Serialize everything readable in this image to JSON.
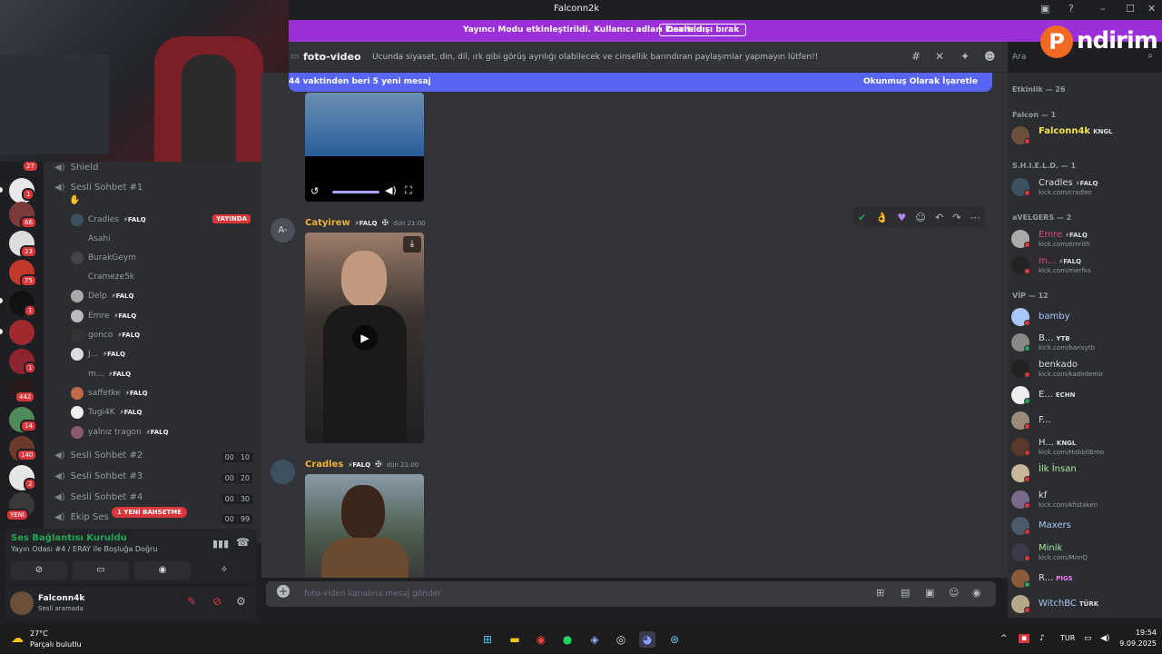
{
  "window": {
    "title": "Falconn2k",
    "minimize": "–",
    "maximize": "☐",
    "close": "✕"
  },
  "banner": {
    "message": "Yayıncı Modu etkinleştirildi. Kullanıcı adları kısaltıldı.",
    "button": "Devre dışı bırak"
  },
  "promo": {
    "logo_letter": "P",
    "text": "ndirim"
  },
  "channel": {
    "name": "foto-video",
    "topic": "Ucunda siyaset, din, dil, ırk gibi görüş ayrılığı olabilecek ve cinsellik barındıran paylaşımlar yapmayın lütfen!!",
    "search_placeholder": "Ara"
  },
  "new_messages": {
    "text": "44 vaktinden beri 5 yeni mesaj",
    "mark_read": "Okunmuş Olarak İşaretle"
  },
  "messages": [
    {
      "author": "Catyirew",
      "tag": "⚡FALQ",
      "time": "dün 21:00",
      "avatar_text": "A-"
    },
    {
      "author": "Cradles",
      "tag": "⚡FALQ",
      "time": "dün 21:00"
    }
  ],
  "composer": {
    "placeholder": "foto-video kanalına mesaj gönder"
  },
  "sidebar": {
    "top_channel": "Shield",
    "voice_channels": [
      {
        "name": "Sesli Sohbet #1",
        "emoji": "✋"
      },
      {
        "name": "Sesli Sohbet #2",
        "count_a": "00",
        "count_b": "10"
      },
      {
        "name": "Sesli Sohbet #3",
        "count_a": "00",
        "count_b": "20"
      },
      {
        "name": "Sesli Sohbet #4",
        "count_a": "00",
        "count_b": "30"
      },
      {
        "name": "Ekip Ses",
        "count_a": "00",
        "count_b": "99"
      }
    ],
    "live_badge": "YAYINDA",
    "new_mention": "1 YENİ BAHSETME",
    "new_label": "YENİ",
    "voice_users": [
      {
        "name": "Cradles",
        "tag": "⚡FALQ"
      },
      {
        "name": "Asahi",
        "tag": ""
      },
      {
        "name": "BurakGeym",
        "tag": ""
      },
      {
        "name": "Crameze5k",
        "tag": ""
      },
      {
        "name": "Delp",
        "tag": "⚡FALQ"
      },
      {
        "name": "Emre",
        "tag": "⚡FALQ"
      },
      {
        "name": "gonco",
        "tag": "⚡FALQ"
      },
      {
        "name": "J...",
        "tag": "⚡FALQ"
      },
      {
        "name": "m...",
        "tag": "⚡FALQ"
      },
      {
        "name": "saffetke",
        "tag": "⚡FALQ"
      },
      {
        "name": "Tugi4K",
        "tag": "⚡FALQ"
      },
      {
        "name": "yalnız tragon",
        "tag": "⚡FALQ"
      }
    ]
  },
  "rail_badges": [
    "27",
    "1",
    "66",
    "23",
    "75",
    "1",
    "1",
    "442",
    "14",
    "140",
    "2"
  ],
  "voice_panel": {
    "status": "Ses Bağlantısı Kuruldu",
    "room": "Yayın Odası #4 / ERAY ile Boşluğa Doğru"
  },
  "user_panel": {
    "name": "Falconn4k",
    "status": "Sesli aramada"
  },
  "members": {
    "activity": "Etkinlik — 26",
    "groups": [
      {
        "title": "Falcon — 1"
      },
      {
        "title": "S.H.I.E.L.D. — 1"
      },
      {
        "title": "aVELGERS — 2"
      },
      {
        "title": "VİP — 12"
      }
    ],
    "list": [
      {
        "name": "Falconn4k",
        "tag": "KNGL",
        "sub": "",
        "color": "#f0e442"
      },
      {
        "name": "Cradles",
        "tag": "⚡FALQ",
        "sub": "kick.com/cradles",
        "color": "#dbdee1"
      },
      {
        "name": "Emre",
        "tag": "⚡FALQ",
        "sub": "kick.com/emrith",
        "color": "#e0457b"
      },
      {
        "name": "m...",
        "tag": "⚡FALQ",
        "sub": "kick.com/merfks",
        "color": "#e0457b"
      },
      {
        "name": "bamby",
        "tag": "",
        "sub": "",
        "color": "#a8c7fa"
      },
      {
        "name": "B...",
        "tag": "YTB",
        "sub": "kick.com/barisytb",
        "color": "#dbdee1"
      },
      {
        "name": "benkado",
        "tag": "",
        "sub": "kick.com/kadirdemir",
        "color": "#dbdee1"
      },
      {
        "name": "E...",
        "tag": "ECHN",
        "sub": "",
        "color": "#dbdee1"
      },
      {
        "name": "F...",
        "tag": "",
        "sub": "",
        "color": "#dbdee1"
      },
      {
        "name": "H...",
        "tag": "KNGL",
        "sub": "kick.com/HobbitEmo",
        "color": "#dbdee1"
      },
      {
        "name": "İlk İnsan",
        "tag": "",
        "sub": "",
        "color": "#a8e6a1"
      },
      {
        "name": "kf",
        "tag": "",
        "sub": "kick.com/kfistaken",
        "color": "#dbdee1"
      },
      {
        "name": "Maxers",
        "tag": "",
        "sub": "",
        "color": "#a8c7fa"
      },
      {
        "name": "Minik",
        "tag": "",
        "sub": "kick.com/MnnQ",
        "color": "#a8e6a1"
      },
      {
        "name": "R...",
        "tag": "PIGS",
        "sub": "",
        "color": "#dbdee1"
      },
      {
        "name": "WitchBC",
        "tag": "TÜRK",
        "sub": "",
        "color": "#a8c7fa"
      }
    ]
  },
  "taskbar": {
    "temperature": "27°C",
    "weather": "Parçalı bulutlu",
    "language": "TUR",
    "time": "19:54",
    "date": "9.09.2025"
  },
  "colors": {
    "accent": "#5865f2",
    "banner": "#9b30d9",
    "live": "#da373c",
    "online": "#23a55a"
  }
}
